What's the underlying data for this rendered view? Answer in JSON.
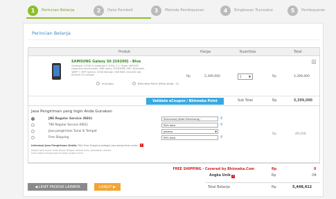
{
  "steps": [
    {
      "num": "1",
      "label": "Perincian Belanja"
    },
    {
      "num": "2",
      "label": "Data Pembeli"
    },
    {
      "num": "3",
      "label": "Metode Pembayaran"
    },
    {
      "num": "4",
      "label": "Ringkasan Transaksi"
    },
    {
      "num": "5",
      "label": "Pembayaran"
    }
  ],
  "card_title": "Perincian Belanja",
  "table": {
    "headers": {
      "product": "Produk",
      "price": "Harga",
      "qty": "Kuantitas",
      "total": "Total"
    },
    "product": {
      "name": "SAMSUNG Galaxy S6 [G9200] - Blue",
      "description": "Quadcore 1.5GHz & quadcore 2.1GHz, 5.1\" Super AMOLED capacitive touchscreen, 16M colors, LTE/HSDPA, WiFi, Bluetooth, 16MP + 5MP Camera, 32GB Storage, 3GB RAM, microSD slot, Android 5.0 Lollipop",
      "price_currency": "Rp",
      "price": "5,399,000",
      "qty": "1",
      "total_currency": "Rp",
      "total": "5,399,000",
      "opt1": "eCoupon",
      "opt2": "Bhinneka Point (Point Anda : 0)"
    },
    "validate_button": "Validate eCoupon / Bhinneka Point",
    "subtotal_label": "Sub Total",
    "subtotal_currency": "Rp",
    "subtotal": "5,399,000"
  },
  "shipping": {
    "title": "Jasa Pengiriman yang Ingin Anda Gunakan",
    "options": [
      {
        "name": "JNE Regular Service (REG)",
        "input": "Semarang (Kota Semarang)"
      },
      {
        "name": "TIKI Regular Service (REG)",
        "input": "Pilih kota"
      },
      {
        "name": "Jasa pengiriman Tunai di Tempat",
        "input": "Jakarta"
      },
      {
        "name": "Free Shipping",
        "input": "Pilih kota"
      }
    ],
    "note_bold": "Informasi Jasa Pengiriman Gratis:",
    "note_rest": "Pilih Free Shipping sebagai jasa pengiriman anda",
    "note2": "Mohon kota tujuan anda sesuai dengan alamat kirim, perubahan alamat kirim dapat mempengaruhi biaya ongkos kirim.",
    "cost_currency": "Rp",
    "cost": "49,416"
  },
  "footer": {
    "free_label": "FREE SHIPPING - Covered by Bhinneka.Com",
    "free_currency": "Rp",
    "free_value": "0",
    "unik_label": "Angka Unik",
    "unik_currency": "Rp",
    "unik_value": "-04"
  },
  "buttons": {
    "back": "◀  LIHAT PRODUK LAINNYA",
    "next": "LANJUT ▶"
  },
  "total": {
    "label": "Total Belanja",
    "currency": "Rp",
    "value": "5,448,412"
  }
}
